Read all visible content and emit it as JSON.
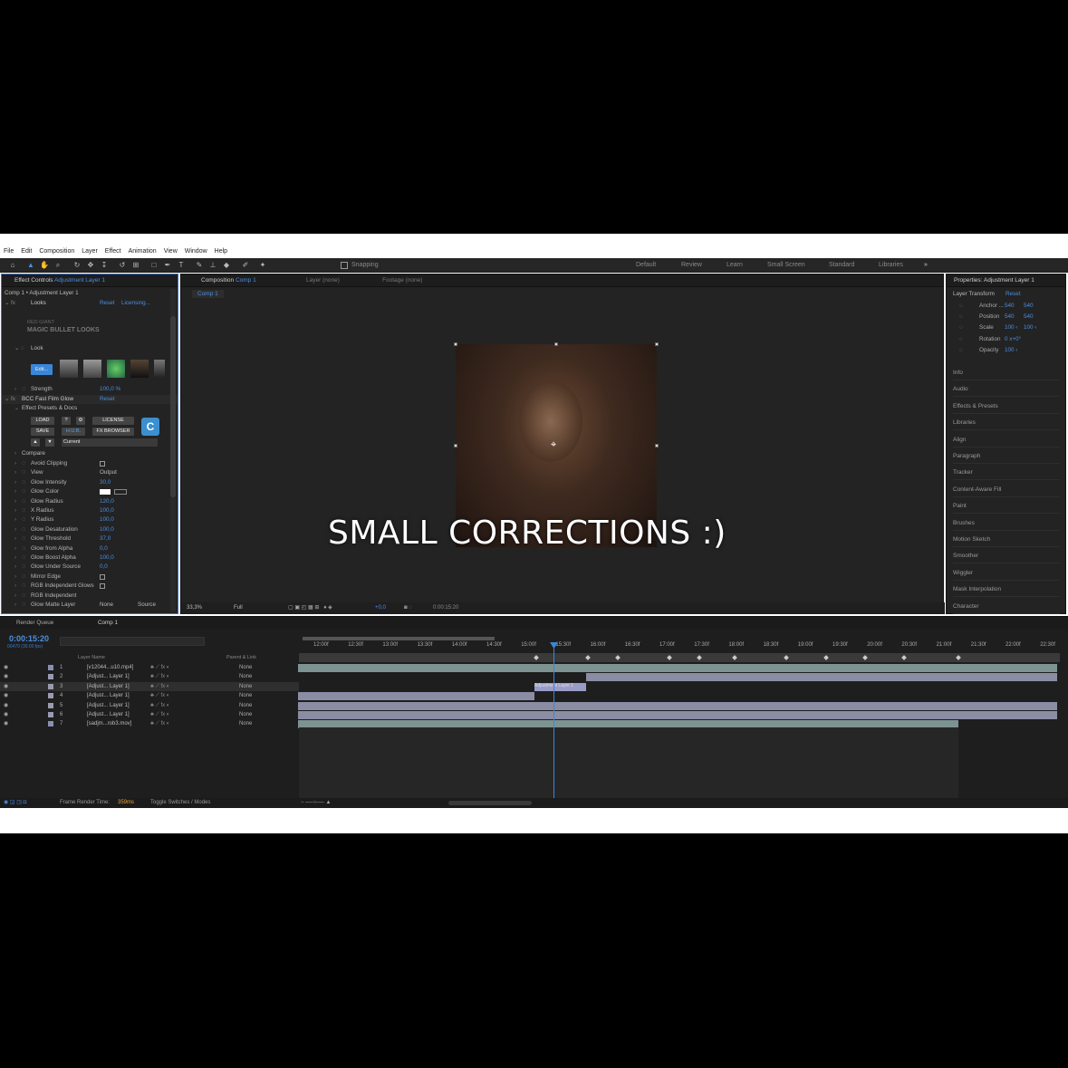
{
  "menu": [
    "File",
    "Edit",
    "Composition",
    "Layer",
    "Effect",
    "Animation",
    "View",
    "Window",
    "Help"
  ],
  "toolbar": {
    "snapping": "Snapping",
    "workspaces": [
      "Default",
      "Review",
      "Learn",
      "Small Screen",
      "Standard",
      "Libraries"
    ],
    "more": "»"
  },
  "effect_controls": {
    "tab": "Effect Controls",
    "tab_target": "Adjustment Layer 1",
    "subtitle": "Comp 1 • Adjustment Layer 1",
    "looks": {
      "name": "Looks",
      "reset": "Reset",
      "licensing": "Licensing...",
      "brand1": "RED GIANT",
      "brand2": "MAGIC BULLET LOOKS",
      "look": "Look",
      "edit": "Edit...",
      "strength_label": "Strength",
      "strength": "100,0 %"
    },
    "bcc": {
      "name": "BCC Fast Film Glow",
      "reset": "Reset",
      "presets": "Effect Presets & Docs",
      "load": "LOAD",
      "q": "?",
      "gear": "⚙",
      "license": "LICENSE",
      "save": "SAVE",
      "hub": "H.U.B.",
      "fxbrowser": "FX BROWSER",
      "current": "Current",
      "compare": "Compare",
      "logo": "C"
    },
    "params": [
      {
        "label": "Avoid Clipping",
        "value": ""
      },
      {
        "label": "View",
        "value": "Output"
      },
      {
        "label": "Glow Intensity",
        "value": "30,0"
      },
      {
        "label": "Glow Color",
        "value": ""
      },
      {
        "label": "Glow Radius",
        "value": "120,0"
      },
      {
        "label": "X Radius",
        "value": "100,0"
      },
      {
        "label": "Y Radius",
        "value": "100,0"
      },
      {
        "label": "Glow Desaturation",
        "value": "100,0"
      },
      {
        "label": "Glow Threshold",
        "value": "37,0"
      },
      {
        "label": "Glow from Alpha",
        "value": "0,0"
      },
      {
        "label": "Glow Boost Alpha",
        "value": "100,0"
      },
      {
        "label": "Glow Under Source",
        "value": "0,0"
      },
      {
        "label": "Mirror Edge",
        "value": ""
      },
      {
        "label": "RGB Independent Glows",
        "value": ""
      },
      {
        "label": "RGB Independent",
        "value": ""
      },
      {
        "label": "Glow Matte Layer",
        "value": "None"
      }
    ],
    "matte_source": "Source"
  },
  "composition": {
    "tab": "Composition",
    "tab_target": "Comp 1",
    "layer_tab": "Layer (none)",
    "footage_tab": "Footage (none)",
    "sub_tab": "Comp 1",
    "zoom": "33,3%",
    "quality": "Full",
    "exposure": "+0,0",
    "time": "0:00:15:20",
    "caption": "SMALL CORRECTIONS :)"
  },
  "properties": {
    "title": "Properties: Adjustment Layer 1",
    "section": "Layer Transform",
    "reset": "Reset",
    "rows": [
      {
        "label": "Anchor ...",
        "v1": "540",
        "v2": "540"
      },
      {
        "label": "Position",
        "v1": "540",
        "v2": "540"
      },
      {
        "label": "Scale",
        "v1": "100 ‹",
        "v2": "100 ‹"
      },
      {
        "label": "Rotation",
        "v1": "0 x+0°",
        "v2": ""
      },
      {
        "label": "Opacity",
        "v1": "100 ‹",
        "v2": ""
      }
    ],
    "panels": [
      "Info",
      "Audio",
      "Effects & Presets",
      "Libraries",
      "Align",
      "Paragraph",
      "Tracker",
      "Content-Aware Fill",
      "Paint",
      "Brushes",
      "Motion Sketch",
      "Smoother",
      "Wiggler",
      "Mask Interpolation",
      "Character"
    ]
  },
  "timeline": {
    "render_queue": "Render Queue",
    "comp_tab": "Comp 1",
    "timecode": "0:00:15:20",
    "fps": "00470 (30.00 fps)",
    "col_layer": "Layer Name",
    "col_parent": "Parent & Link",
    "ruler": [
      "12:00f",
      "12:30f",
      "13:00f",
      "13:30f",
      "14:00f",
      "14:30f",
      "15:00f",
      "15:30f",
      "16:00f",
      "16:30f",
      "17:00f",
      "17:30f",
      "18:00f",
      "18:30f",
      "19:00f",
      "19:30f",
      "20:00f",
      "20:30f",
      "21:00f",
      "21:30f",
      "22:00f",
      "22:30f"
    ],
    "layers": [
      {
        "n": "1",
        "name": "[v12044...u10.mp4]",
        "parent": "None"
      },
      {
        "n": "2",
        "name": "[Adjust... Layer 1]",
        "parent": "None"
      },
      {
        "n": "3",
        "name": "[Adjust... Layer 1]",
        "parent": "None"
      },
      {
        "n": "4",
        "name": "[Adjust... Layer 1]",
        "parent": "None"
      },
      {
        "n": "5",
        "name": "[Adjust... Layer 1]",
        "parent": "None"
      },
      {
        "n": "6",
        "name": "[Adjust... Layer 1]",
        "parent": "None"
      },
      {
        "n": "7",
        "name": "[sadjm...rob3.mov]",
        "parent": "None"
      }
    ],
    "clip3_label": "Adjustment Layer 1",
    "status_render_label": "Frame Render Time:",
    "status_render": "359ms",
    "toggle": "Toggle Switches / Modes"
  },
  "colors": {
    "accent": "#2d8ceb",
    "panel": "#232323",
    "bar_teal": "#7c9392",
    "bar_purple": "#8a8da3"
  }
}
